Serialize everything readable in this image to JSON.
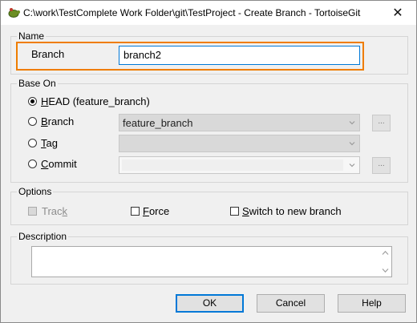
{
  "window": {
    "title": "C:\\work\\TestComplete Work Folder\\git\\TestProject - Create Branch - TortoiseGit",
    "close_glyph": "✕",
    "app_icon": "tortoisegit-icon"
  },
  "name_group": {
    "label": "Name",
    "branch_label": "Branch",
    "branch_value": "branch2"
  },
  "base_on": {
    "label": "Base On",
    "head": {
      "prefix": "H",
      "rest": "EAD (feature_branch)",
      "selected": true
    },
    "branch": {
      "prefix": "B",
      "rest": "ranch",
      "value": "feature_branch",
      "browse": "..."
    },
    "tag": {
      "prefix": "T",
      "rest": "ag",
      "value": ""
    },
    "commit": {
      "prefix": "C",
      "rest": "ommit",
      "value": "",
      "browse": "..."
    }
  },
  "options": {
    "label": "Options",
    "track": {
      "prefix": "Trac",
      "under": "k",
      "checked": true,
      "disabled": true
    },
    "force": {
      "prefix": "F",
      "rest": "orce",
      "checked": false
    },
    "switch": {
      "prefix": "S",
      "rest": "witch to new branch",
      "checked": false
    }
  },
  "description": {
    "label": "Description",
    "value": ""
  },
  "buttons": {
    "ok": "OK",
    "cancel": "Cancel",
    "help": "Help"
  },
  "colors": {
    "focus_highlight": "#ef7d00",
    "dialog_bg": "#f0f0f0",
    "default_button_border": "#0078d7"
  }
}
